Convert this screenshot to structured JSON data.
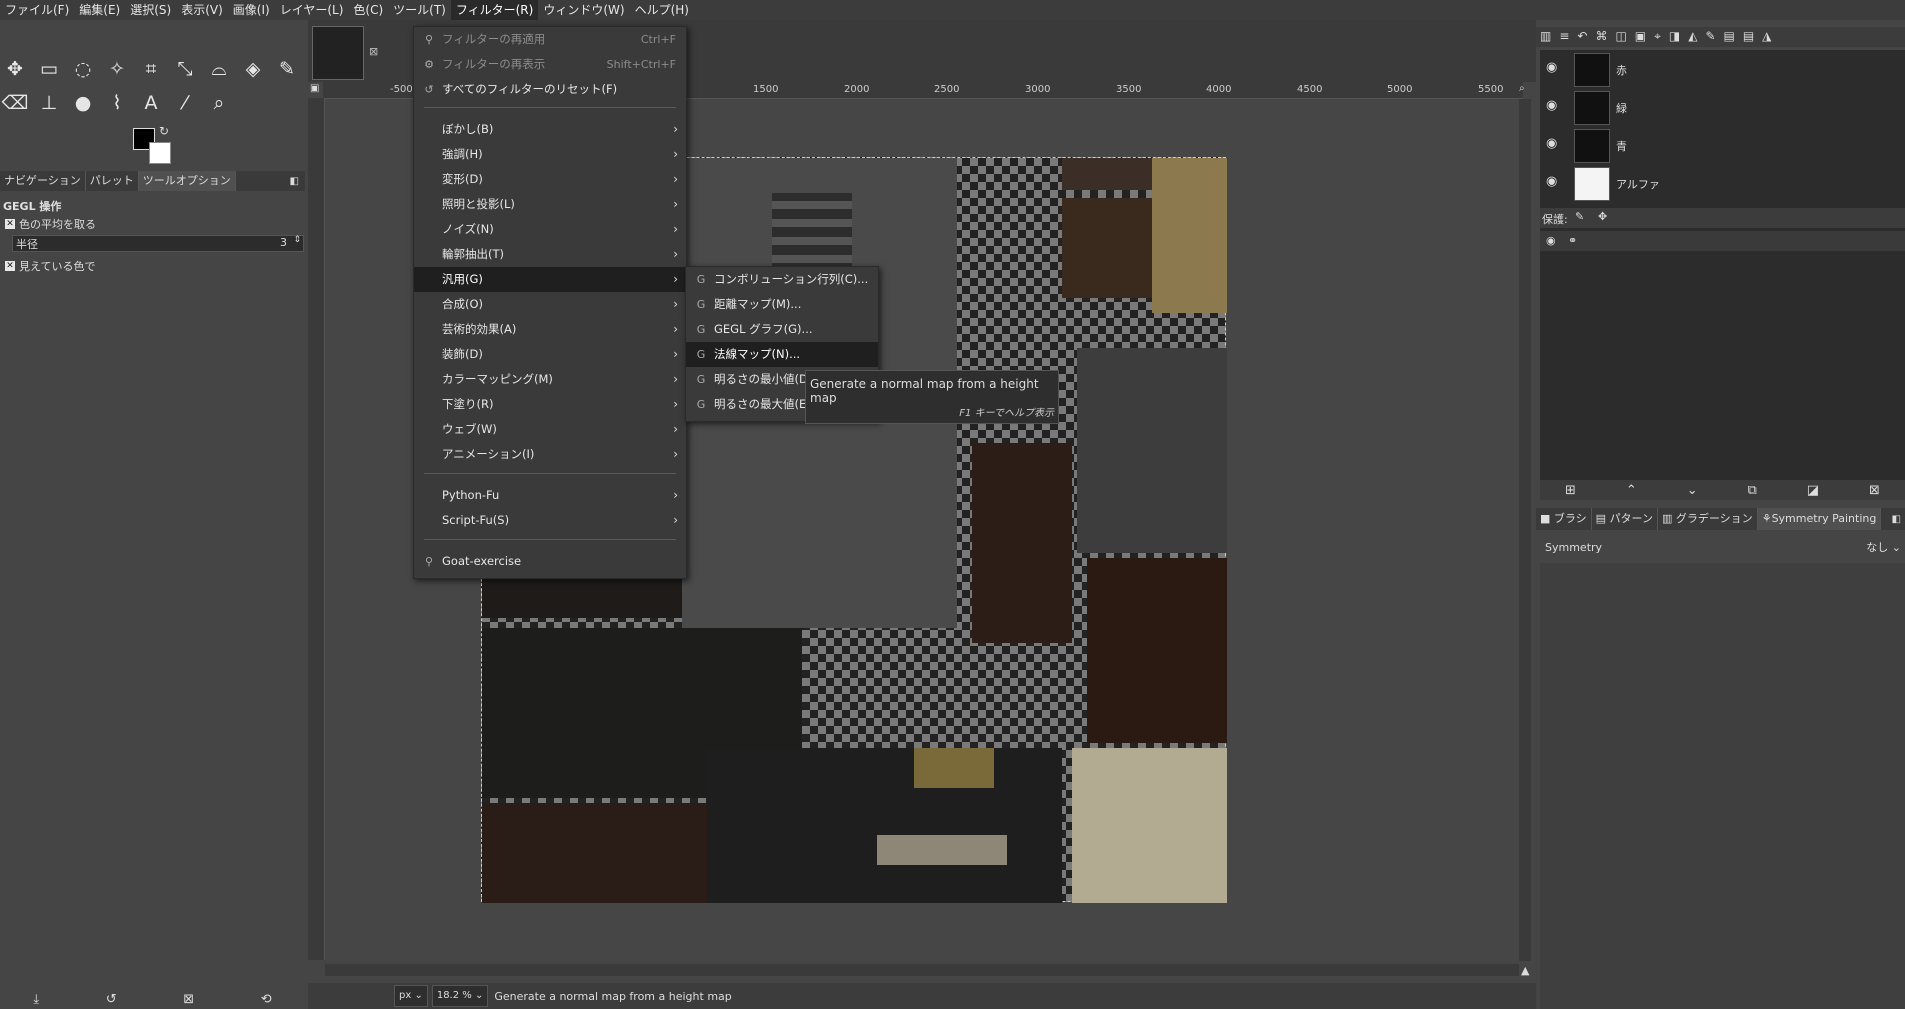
{
  "menubar": [
    "ファイル(F)",
    "編集(E)",
    "選択(S)",
    "表示(V)",
    "画像(I)",
    "レイヤー(L)",
    "色(C)",
    "ツール(T)",
    "フィルター(R)",
    "ウィンドウ(W)",
    "ヘルプ(H)"
  ],
  "left_dock": {
    "tabs": [
      "ナビゲーション",
      "パレット",
      "ツールオプション"
    ],
    "title": "GEGL 操作",
    "opt1": "色の平均を取る",
    "radius_label": "半径",
    "radius_value": "3",
    "opt2": "見えている色で"
  },
  "ruler": [
    "-500",
    "1500",
    "2000",
    "2500",
    "3000",
    "3500",
    "4000",
    "4500",
    "5000",
    "5500"
  ],
  "filters_menu": {
    "reapply": {
      "label": "フィルターの再適用",
      "shortcut": "Ctrl+F"
    },
    "reshow": {
      "label": "フィルターの再表示",
      "shortcut": "Shift+Ctrl+F"
    },
    "reset": "すべてのフィルターのリセット(F)",
    "categories": [
      "ぼかし(B)",
      "強調(H)",
      "変形(D)",
      "照明と投影(L)",
      "ノイズ(N)",
      "輪郭抽出(T)",
      "汎用(G)",
      "合成(O)",
      "芸術的効果(A)",
      "装飾(D)",
      "カラーマッピング(M)",
      "下塗り(R)",
      "ウェブ(W)",
      "アニメーション(I)"
    ],
    "python": "Python-Fu",
    "script": "Script-Fu(S)",
    "goat": "Goat-exercise"
  },
  "generic_submenu": [
    "コンボリューション行列(C)...",
    "距離マップ(M)...",
    "GEGL グラフ(G)...",
    "法線マップ(N)...",
    "明るさの最小値(D)",
    "明るさの最大値(E)"
  ],
  "tooltip": {
    "text": "Generate a normal map from a height map",
    "hint": "F1 キーでヘルプ表示"
  },
  "layers": [
    "赤",
    "緑",
    "青",
    "アルファ"
  ],
  "lock_label": "保護:",
  "right_tabs": [
    "ブラシ",
    "パターン",
    "グラデーション",
    "Symmetry Painting"
  ],
  "symmetry": {
    "label": "Symmetry",
    "value": "なし"
  },
  "status": {
    "unit": "px",
    "zoom": "18.2 %",
    "message": "Generate a normal map from a height map"
  }
}
